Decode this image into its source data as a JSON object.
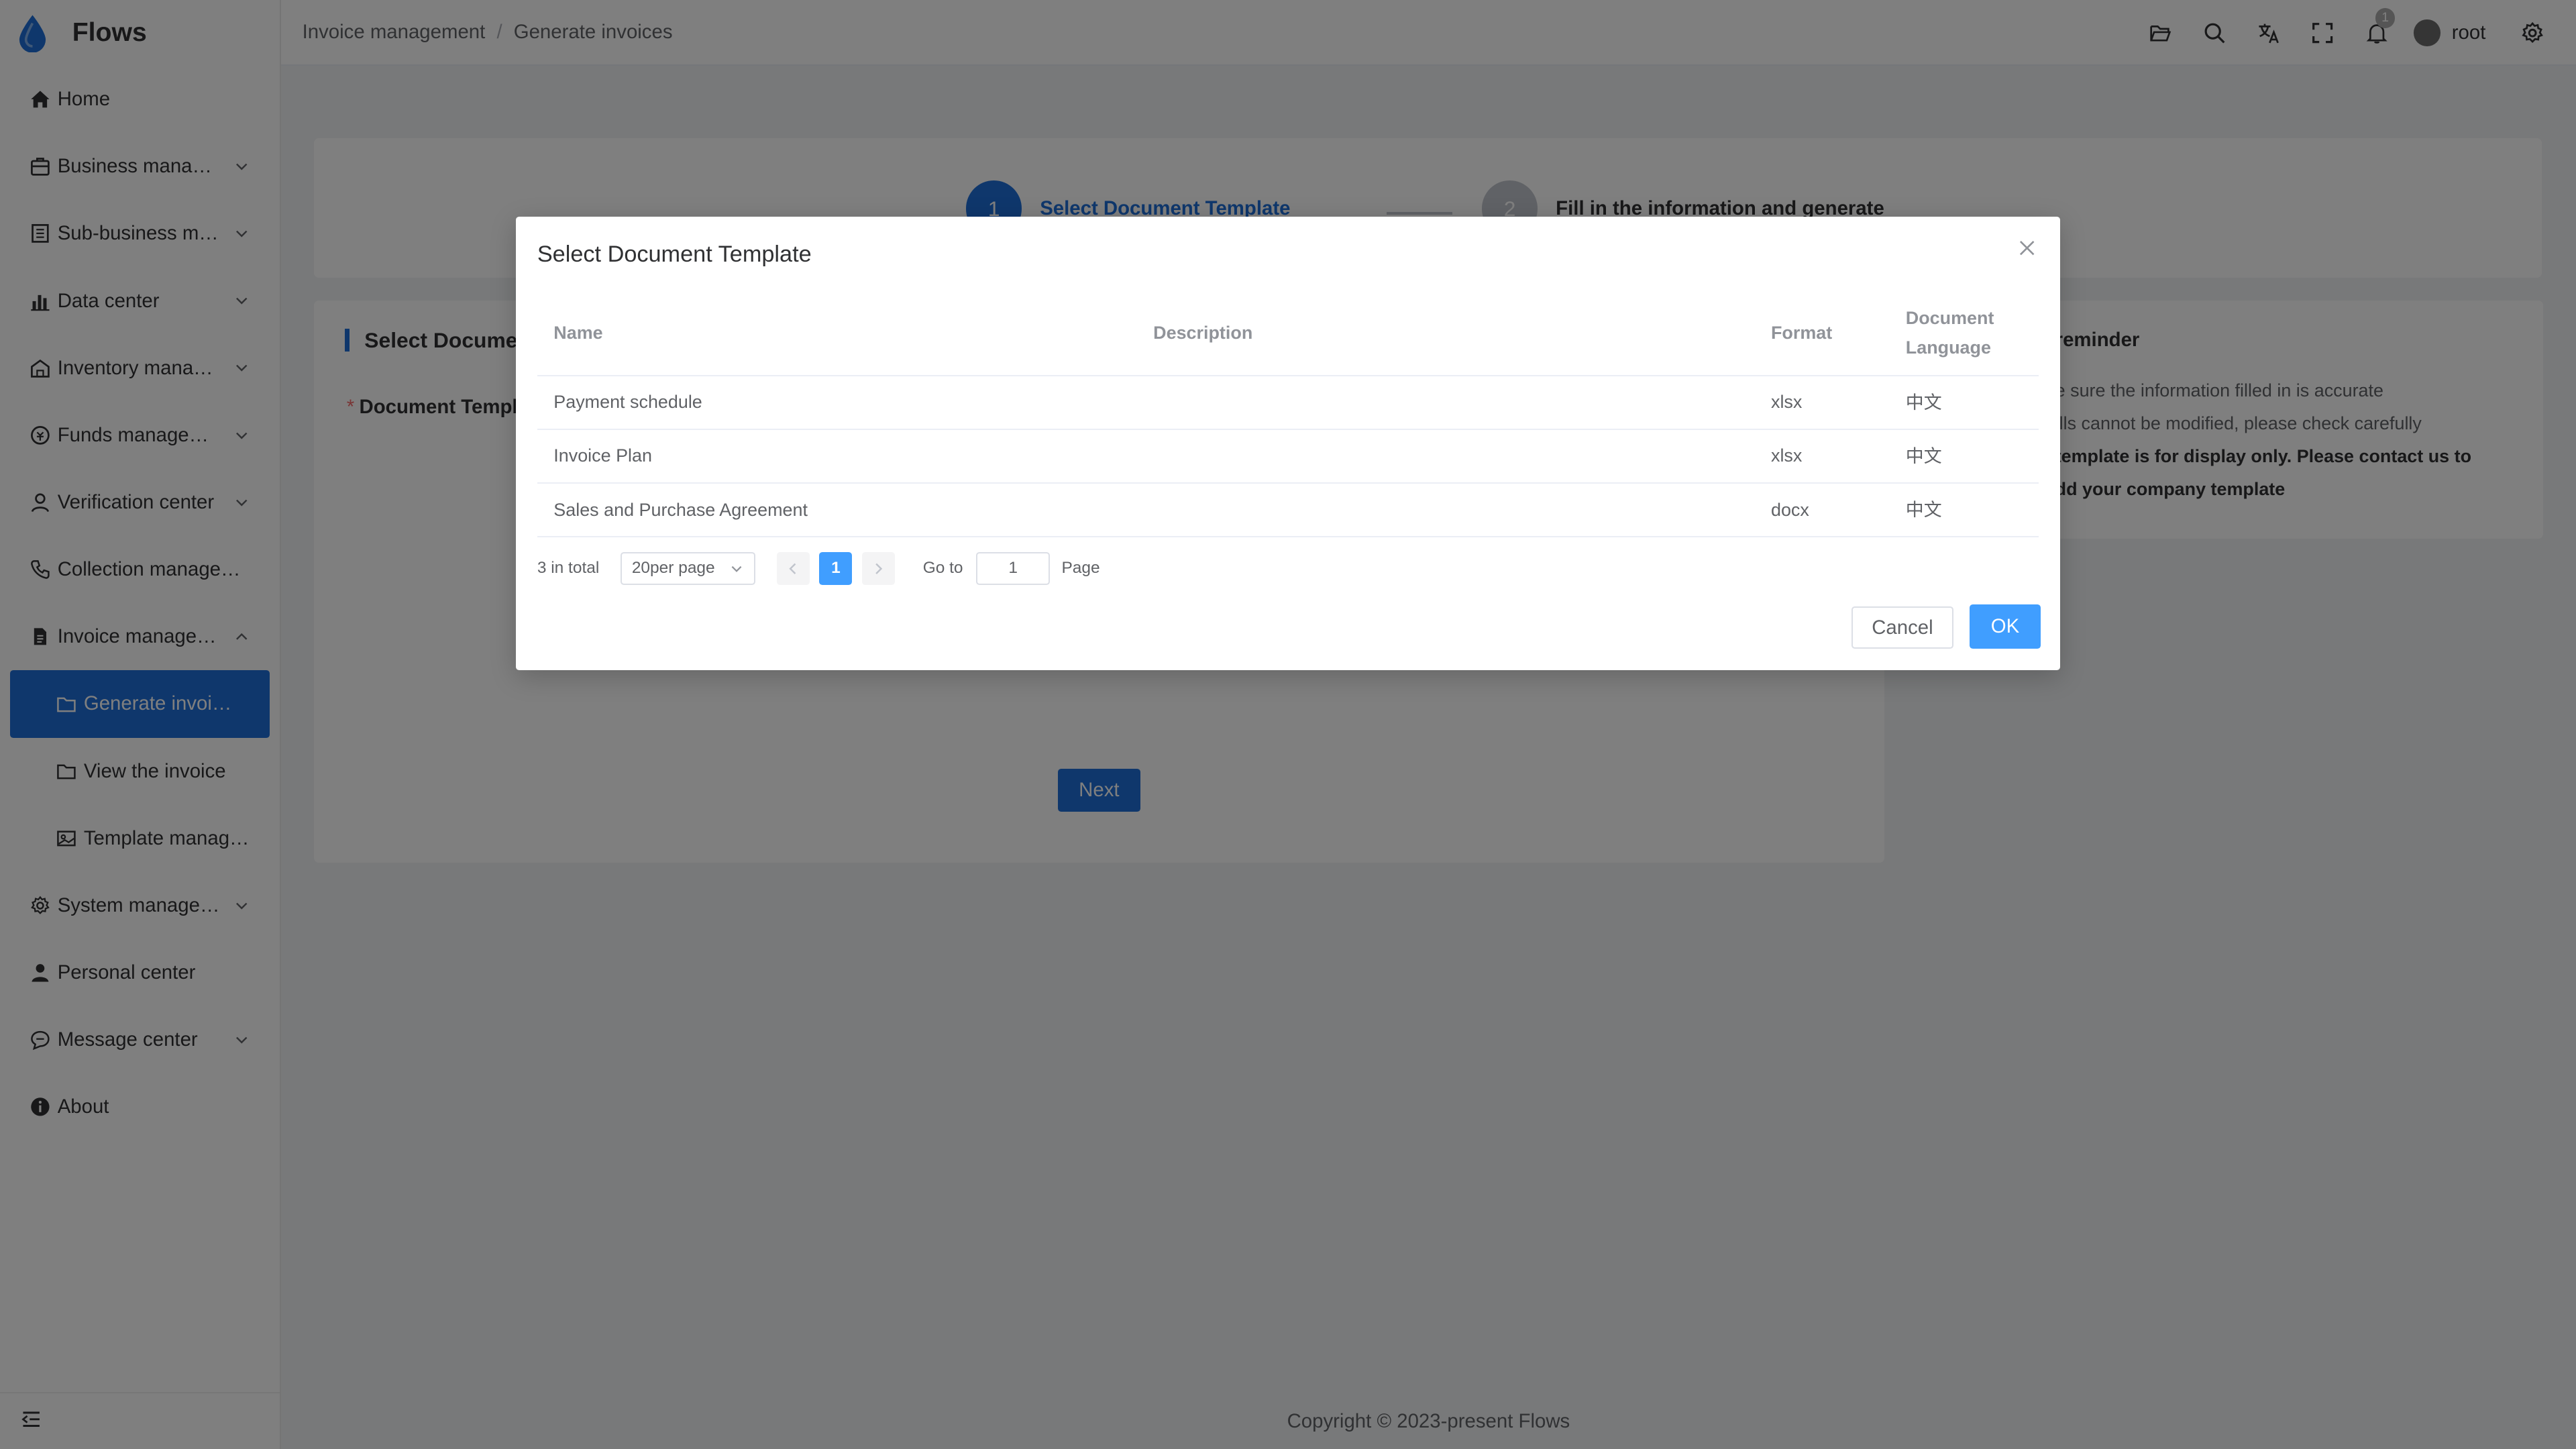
{
  "app": {
    "name": "Flows"
  },
  "sidebar": {
    "items": [
      {
        "label": "Home",
        "icon": "home-icon"
      },
      {
        "label": "Business manag…",
        "icon": "briefcase-icon",
        "expandable": true
      },
      {
        "label": "Sub-business m…",
        "icon": "building-icon",
        "expandable": true
      },
      {
        "label": "Data center",
        "icon": "chart-icon",
        "expandable": true
      },
      {
        "label": "Inventory manag…",
        "icon": "warehouse-icon",
        "expandable": true
      },
      {
        "label": "Funds managem…",
        "icon": "coin-icon",
        "expandable": true
      },
      {
        "label": "Verification center",
        "icon": "user-check-icon",
        "expandable": true
      },
      {
        "label": "Collection managem…",
        "icon": "phone-icon"
      },
      {
        "label": "Invoice manage…",
        "icon": "document-icon",
        "expanded": true
      },
      {
        "label": "Generate invoices",
        "icon": "folder-icon",
        "sub": true,
        "active": true
      },
      {
        "label": "View the invoice",
        "icon": "folder-icon",
        "sub": true
      },
      {
        "label": "Template manage…",
        "icon": "image-icon",
        "sub": true
      },
      {
        "label": "System manage…",
        "icon": "gear-icon",
        "expandable": true
      },
      {
        "label": "Personal center",
        "icon": "person-icon"
      },
      {
        "label": "Message center",
        "icon": "message-icon",
        "expandable": true
      },
      {
        "label": "About",
        "icon": "info-icon"
      }
    ]
  },
  "header": {
    "breadcrumb": [
      "Invoice management",
      "Generate invoices"
    ],
    "notification_count": "1",
    "user": "root"
  },
  "steps": [
    {
      "number": "1",
      "title": "Select Document Template"
    },
    {
      "number": "2",
      "title": "Fill in the information and generate"
    }
  ],
  "form": {
    "title": "Select Docume",
    "label": "Document Templa",
    "required_mark": "*",
    "next_label": "Next"
  },
  "reminder": {
    "title": "reminder",
    "lines": [
      "e sure the information filled in is accurate",
      "ills cannot be modified, please check carefully",
      "template is for display only. Please contact us to",
      "dd your company template"
    ]
  },
  "footer": {
    "copyright": "Copyright © 2023-present Flows"
  },
  "dialog": {
    "title": "Select Document Template",
    "columns": {
      "name": "Name",
      "description": "Description",
      "format": "Format",
      "language_1": "Document",
      "language_2": "Language"
    },
    "rows": [
      {
        "name": "Payment schedule",
        "description": "",
        "format": "xlsx",
        "language": "中文"
      },
      {
        "name": "Invoice Plan",
        "description": "",
        "format": "xlsx",
        "language": "中文"
      },
      {
        "name": "Sales and Purchase Agreement",
        "description": "",
        "format": "docx",
        "language": "中文"
      }
    ],
    "pagination": {
      "total": "3 in total",
      "page_size": "20per page",
      "current_page": "1",
      "goto_label": "Go to",
      "goto_value": "1",
      "page_label": "Page"
    },
    "cancel_label": "Cancel",
    "ok_label": "OK"
  },
  "colors": {
    "primary": "#1e6fd9",
    "accent": "#409eff"
  }
}
